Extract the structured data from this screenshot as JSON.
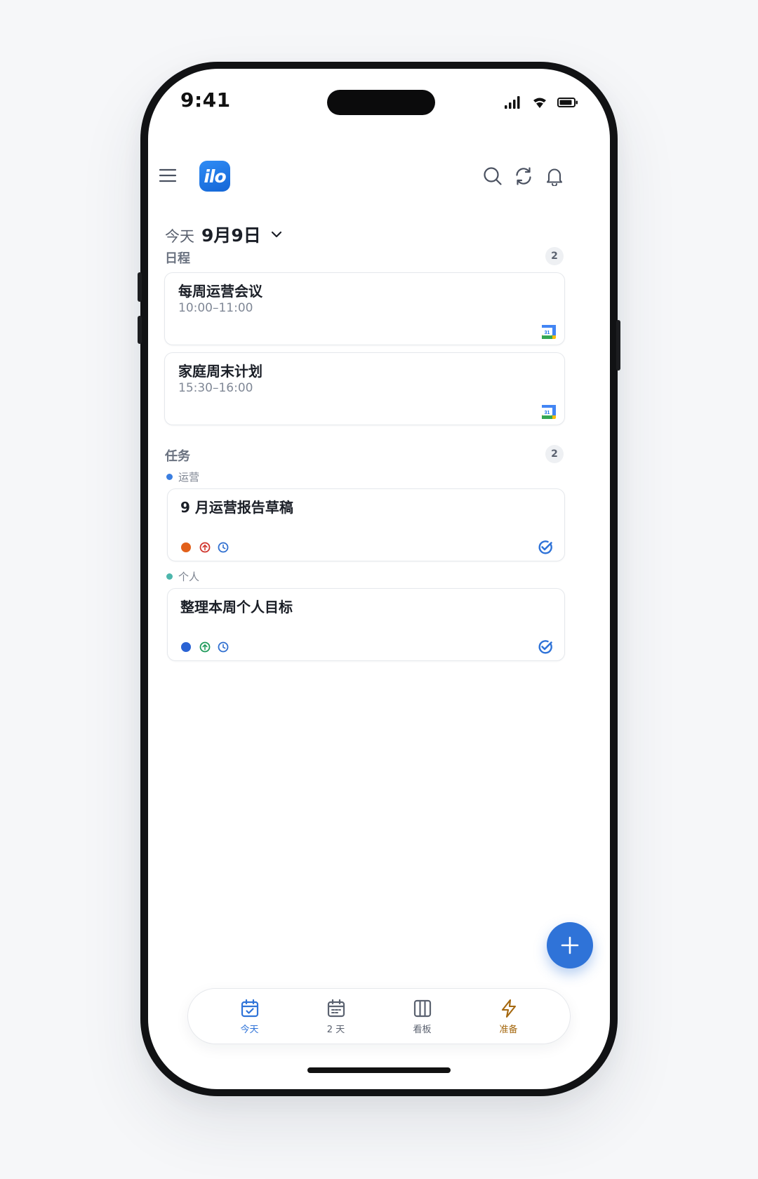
{
  "status_bar": {
    "time": "9:41"
  },
  "app": {
    "logo_text": "ilo"
  },
  "header": {
    "icons": [
      "menu-icon",
      "search-icon",
      "sync-icon",
      "bell-icon"
    ]
  },
  "date_selector": {
    "today_label": "今天",
    "date": "9月9日"
  },
  "schedule": {
    "title": "日程",
    "count": "2",
    "events": [
      {
        "title": "每周运营会议",
        "time": "10:00–11:00",
        "source_icon": "google-calendar-icon",
        "badge": "31"
      },
      {
        "title": "家庭周末计划",
        "time": "15:30–16:00",
        "source_icon": "google-calendar-icon",
        "badge": "31"
      }
    ]
  },
  "tasks": {
    "title": "任务",
    "count": "2",
    "groups": [
      {
        "label": "运营",
        "dot_color": "#3b7ee0",
        "items": [
          {
            "title": "9 月运营报告草稿",
            "status_color": "#e2601a",
            "priority_color": "#d0342c",
            "priority": "high",
            "clock_color": "#2f6fd0",
            "source_icon": "check-circle-icon"
          }
        ]
      },
      {
        "label": "个人",
        "dot_color": "#4db6ac",
        "items": [
          {
            "title": "整理本周个人目标",
            "status_color": "#2a63d4",
            "priority_color": "#1e9a5a",
            "priority": "normal",
            "clock_color": "#2f6fd0",
            "source_icon": "check-circle-icon"
          }
        ]
      }
    ]
  },
  "fab": {
    "icon": "plus-icon"
  },
  "tab_bar": {
    "tabs": [
      {
        "label": "今天",
        "icon": "calendar-check-icon",
        "color": "#2f73d8",
        "active": true
      },
      {
        "label": "2 天",
        "icon": "calendar-icon",
        "color": "#5b6270",
        "active": false
      },
      {
        "label": "看板",
        "icon": "kanban-icon",
        "color": "#5b6270",
        "active": false
      },
      {
        "label": "准备",
        "icon": "lightning-icon",
        "color": "#a5680f",
        "active": false
      }
    ]
  },
  "colors": {
    "accent": "#2f73d8",
    "text_primary": "#1b1f27",
    "text_secondary": "#808896"
  }
}
